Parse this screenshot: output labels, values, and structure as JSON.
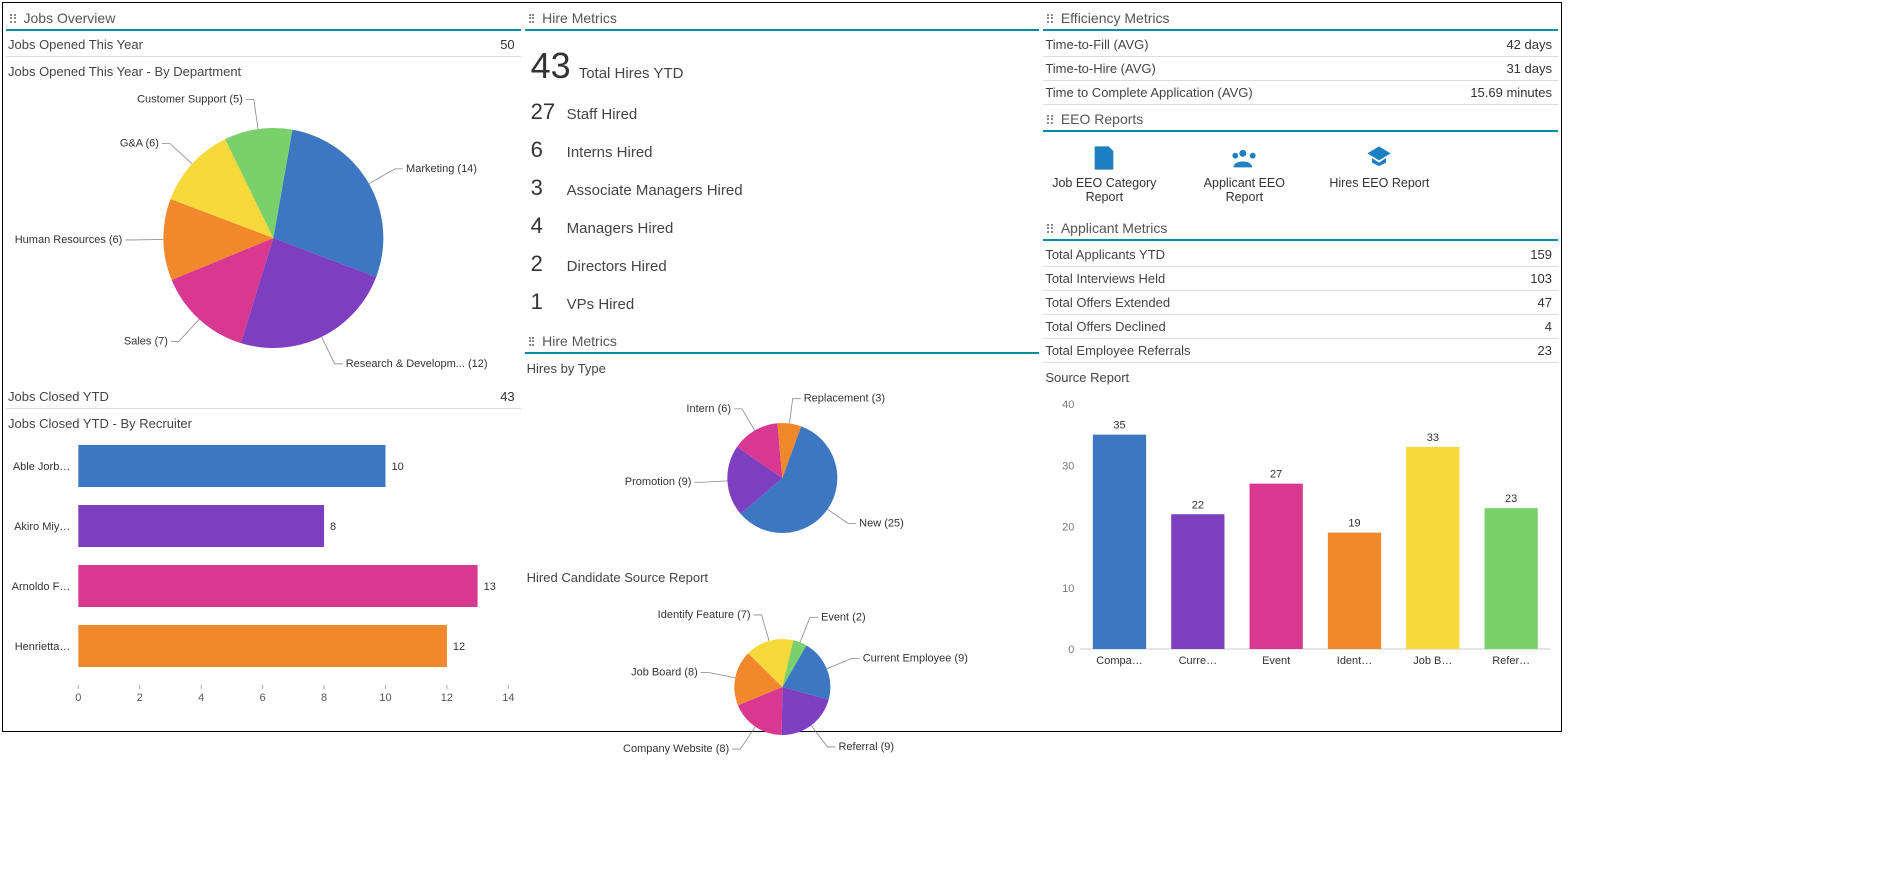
{
  "colors": {
    "blue": "#3E77C1",
    "purple": "#7D3FC0",
    "magenta": "#D93890",
    "orange": "#F1892C",
    "yellow": "#F8D93B",
    "green": "#7AD16B"
  },
  "jobs_overview": {
    "title": "Jobs Overview",
    "opened_label": "Jobs Opened This Year",
    "opened_value": "50",
    "opened_by_dept_label": "Jobs Opened This Year - By Department",
    "closed_label": "Jobs Closed YTD",
    "closed_value": "43",
    "closed_by_recruiter_label": "Jobs Closed YTD - By Recruiter"
  },
  "hire_metrics": {
    "title": "Hire Metrics",
    "total_hires_value": "43",
    "total_hires_label": "Total Hires YTD",
    "lines": [
      {
        "num": "27",
        "label": "Staff Hired"
      },
      {
        "num": "6",
        "label": "Interns Hired"
      },
      {
        "num": "3",
        "label": "Associate Managers Hired"
      },
      {
        "num": "4",
        "label": "Managers Hired"
      },
      {
        "num": "2",
        "label": "Directors Hired"
      },
      {
        "num": "1",
        "label": "VPs Hired"
      }
    ],
    "second_title": "Hire Metrics",
    "hires_by_type_label": "Hires by Type",
    "hired_source_label": "Hired Candidate Source Report"
  },
  "efficiency": {
    "title": "Efficiency Metrics",
    "rows": [
      {
        "label": "Time-to-Fill (AVG)",
        "value": "42 days"
      },
      {
        "label": "Time-to-Hire (AVG)",
        "value": "31 days"
      },
      {
        "label": "Time to Complete Application (AVG)",
        "value": "15.69 minutes"
      }
    ]
  },
  "eeo": {
    "title": "EEO Reports",
    "items": [
      {
        "label": "Job EEO Category Report"
      },
      {
        "label": "Applicant EEO Report"
      },
      {
        "label": "Hires EEO Report"
      }
    ]
  },
  "applicants": {
    "title": "Applicant Metrics",
    "rows": [
      {
        "label": "Total Applicants YTD",
        "value": "159"
      },
      {
        "label": "Total Interviews Held",
        "value": "103"
      },
      {
        "label": "Total Offers Extended",
        "value": "47"
      },
      {
        "label": "Total Offers Declined",
        "value": "4"
      },
      {
        "label": "Total Employee Referrals",
        "value": "23"
      }
    ],
    "source_report_label": "Source Report"
  },
  "chart_data": [
    {
      "id": "jobs_by_dept_pie",
      "type": "pie",
      "title": "Jobs Opened This Year - By Department",
      "series": [
        {
          "name": "Marketing",
          "value": 14,
          "color": "#3E77C1",
          "label": "Marketing (14)"
        },
        {
          "name": "Research & Development",
          "value": 12,
          "color": "#7D3FC0",
          "label": "Research & Developm... (12)"
        },
        {
          "name": "Sales",
          "value": 7,
          "color": "#D93890",
          "label": "Sales (7)"
        },
        {
          "name": "Human Resources",
          "value": 6,
          "color": "#F1892C",
          "label": "Human Resources (6)"
        },
        {
          "name": "G&A",
          "value": 6,
          "color": "#F8D93B",
          "label": "G&A (6)"
        },
        {
          "name": "Customer Support",
          "value": 5,
          "color": "#7AD16B",
          "label": "Customer Support (5)"
        }
      ]
    },
    {
      "id": "jobs_closed_by_recruiter_bar",
      "type": "bar",
      "orientation": "horizontal",
      "title": "Jobs Closed YTD - By Recruiter",
      "xlim": [
        0,
        14
      ],
      "xticks": [
        0,
        2,
        4,
        6,
        8,
        10,
        12,
        14
      ],
      "series": [
        {
          "name": "Able Jorb…",
          "value": 10,
          "color": "#3E77C1"
        },
        {
          "name": "Akiro Miy…",
          "value": 8,
          "color": "#7D3FC0"
        },
        {
          "name": "Arnoldo F…",
          "value": 13,
          "color": "#D93890"
        },
        {
          "name": "Henrietta…",
          "value": 12,
          "color": "#F1892C"
        }
      ]
    },
    {
      "id": "hires_by_type_pie",
      "type": "pie",
      "title": "Hires by Type",
      "series": [
        {
          "name": "New",
          "value": 25,
          "color": "#3E77C1",
          "label": "New (25)"
        },
        {
          "name": "Promotion",
          "value": 9,
          "color": "#7D3FC0",
          "label": "Promotion (9)"
        },
        {
          "name": "Intern",
          "value": 6,
          "color": "#D93890",
          "label": "Intern (6)"
        },
        {
          "name": "Replacement",
          "value": 3,
          "color": "#F1892C",
          "label": "Replacement (3)"
        }
      ]
    },
    {
      "id": "hired_source_pie",
      "type": "pie",
      "title": "Hired Candidate Source Report",
      "series": [
        {
          "name": "Current Employee",
          "value": 9,
          "color": "#3E77C1",
          "label": "Current Employee (9)"
        },
        {
          "name": "Referral",
          "value": 9,
          "color": "#7D3FC0",
          "label": "Referral (9)"
        },
        {
          "name": "Company Website",
          "value": 8,
          "color": "#D93890",
          "label": "Company Website (8)"
        },
        {
          "name": "Job Board",
          "value": 8,
          "color": "#F1892C",
          "label": "Job Board (8)"
        },
        {
          "name": "Identify Feature",
          "value": 7,
          "color": "#F8D93B",
          "label": "Identify Feature (7)"
        },
        {
          "name": "Event",
          "value": 2,
          "color": "#7AD16B",
          "label": "Event (2)"
        }
      ]
    },
    {
      "id": "applicant_source_bar",
      "type": "bar",
      "orientation": "vertical",
      "title": "Source Report",
      "ylim": [
        0,
        40
      ],
      "yticks": [
        0,
        10,
        20,
        30,
        40
      ],
      "series": [
        {
          "name": "Compa…",
          "value": 35,
          "color": "#3E77C1"
        },
        {
          "name": "Curre…",
          "value": 22,
          "color": "#7D3FC0"
        },
        {
          "name": "Event",
          "value": 27,
          "color": "#D93890"
        },
        {
          "name": "Ident…",
          "value": 19,
          "color": "#F1892C"
        },
        {
          "name": "Job B…",
          "value": 33,
          "color": "#F8D93B"
        },
        {
          "name": "Refer…",
          "value": 23,
          "color": "#7AD16B"
        }
      ]
    }
  ]
}
